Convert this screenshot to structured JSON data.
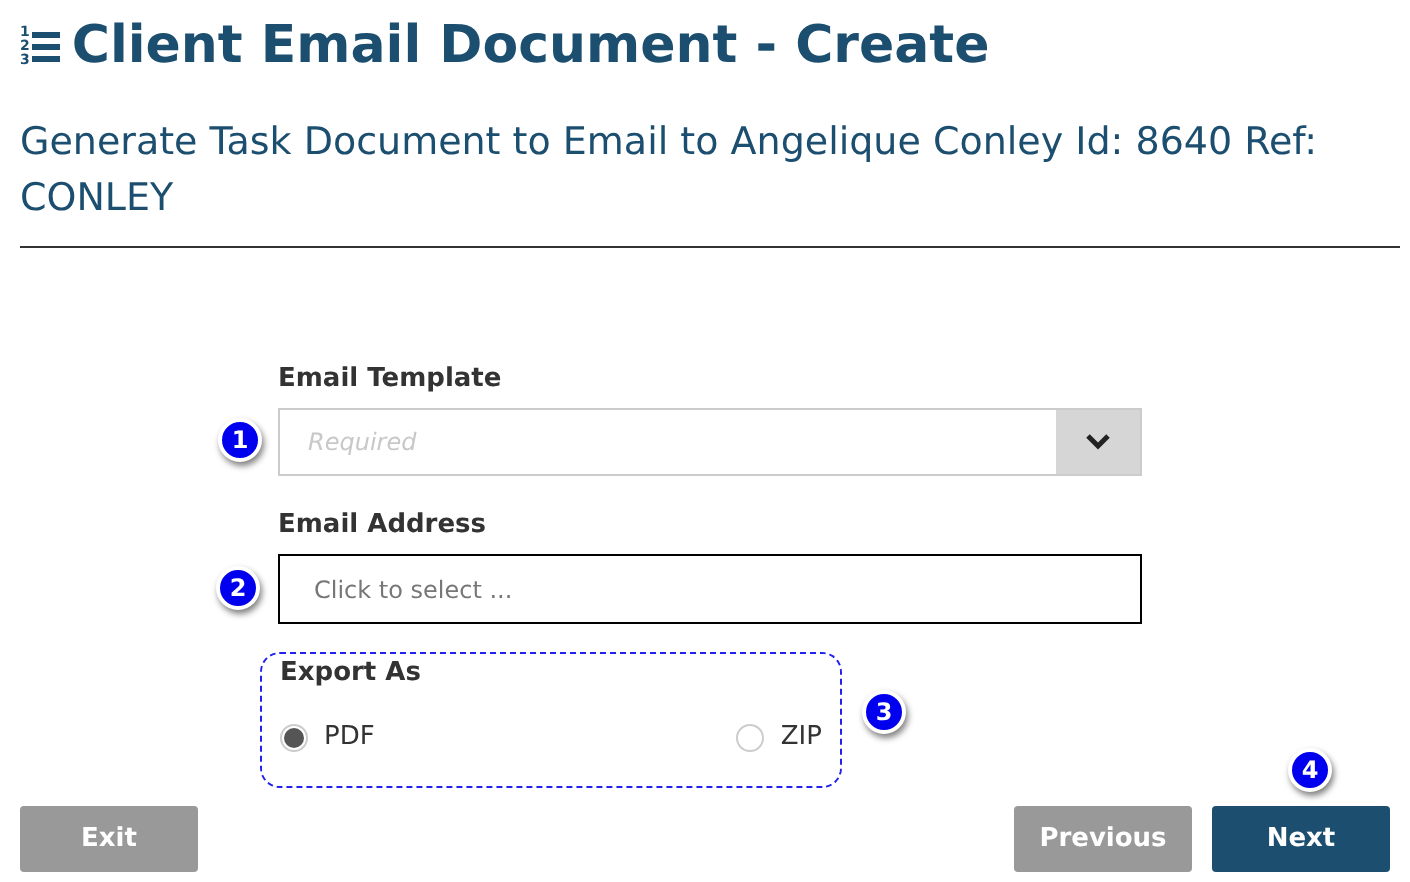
{
  "header": {
    "icon_digits": [
      "1",
      "2",
      "3"
    ],
    "title": "Client Email Document - Create",
    "subtitle": "Generate Task Document to Email to Angelique Conley Id: 8640 Ref: CONLEY"
  },
  "form": {
    "email_template": {
      "label": "Email Template",
      "placeholder": "Required",
      "badge": "1"
    },
    "email_address": {
      "label": "Email Address",
      "placeholder": "Click to select ...",
      "badge": "2"
    },
    "export_as": {
      "label": "Export As",
      "badge": "3",
      "options": [
        {
          "label": "PDF",
          "selected": true
        },
        {
          "label": "ZIP",
          "selected": false
        }
      ]
    }
  },
  "buttons": [
    {
      "label": "Exit",
      "kind": "secondary"
    },
    {
      "label": "Previous",
      "kind": "secondary"
    },
    {
      "label": "Next",
      "kind": "primary",
      "badge": "4"
    }
  ]
}
